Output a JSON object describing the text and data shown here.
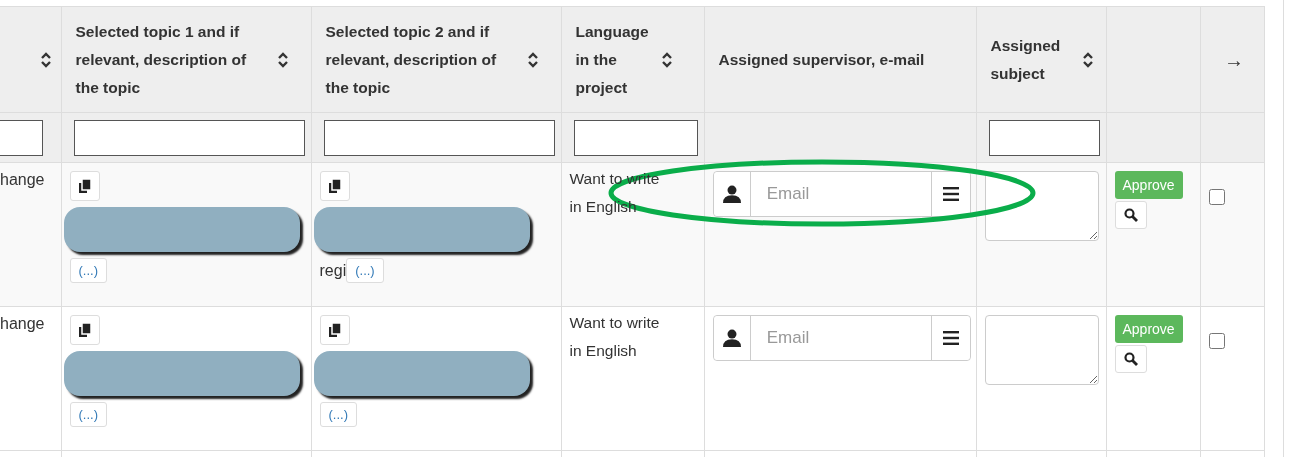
{
  "columns": [
    {
      "sortable": true,
      "filter": true
    },
    {
      "label": "Selected topic 1 and if relevant, description of the topic",
      "sortable": true,
      "filter": true
    },
    {
      "label": "Selected topic 2 and if relevant, description of the topic",
      "sortable": true,
      "filter": true
    },
    {
      "label": "Language in the project",
      "sortable": true,
      "filter": true
    },
    {
      "label": "Assigned supervisor, e-mail",
      "sortable": false,
      "filter": false
    },
    {
      "label": "Assigned subject",
      "sortable": true,
      "filter": true
    },
    {
      "sortable": false,
      "filter": false
    },
    {
      "label": "→",
      "sortable": false,
      "filter": false
    }
  ],
  "rows": [
    {
      "cell_1": "hange",
      "topic_1": {
        "more": "(...)"
      },
      "topic_2": {
        "fragment": "regi",
        "more": "(...)"
      },
      "language": "Want to write in English",
      "supervisor_placeholder": "Email",
      "approve": "Approve",
      "checked": false
    },
    {
      "cell_1": "hange",
      "topic_1": {
        "more": "(...)"
      },
      "topic_2": {
        "more": "(...)"
      },
      "language": "Want to write in English",
      "supervisor_placeholder": "Email",
      "approve": "Approve",
      "checked": false
    }
  ]
}
